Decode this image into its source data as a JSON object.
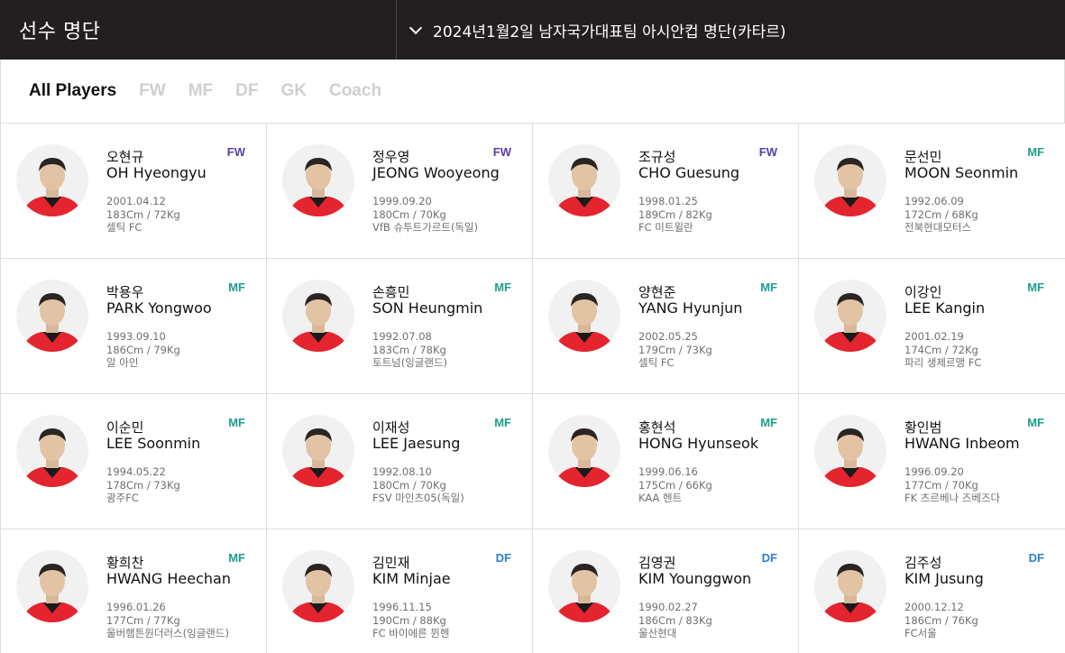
{
  "header": {
    "title": "선수 명단",
    "roster_select": "2024년1월2일 남자국가대표팀 아시안컵 명단(카타르)"
  },
  "filters": [
    "All Players",
    "FW",
    "MF",
    "DF",
    "GK",
    "Coach"
  ],
  "active_filter": "All Players",
  "colors": {
    "FW": "#5a3da6",
    "MF": "#1f9c8c",
    "DF": "#2c7fc9",
    "jersey": "#e4242e",
    "header_bg": "#231f20"
  },
  "players": [
    {
      "kr": "오현규",
      "en": "OH Hyeongyu",
      "pos": "FW",
      "dob": "2001.04.12",
      "body": "183Cm / 72Kg",
      "club": "셀틱 FC"
    },
    {
      "kr": "정우영",
      "en": "JEONG Wooyeong",
      "pos": "FW",
      "dob": "1999.09.20",
      "body": "180Cm / 70Kg",
      "club": "VfB 슈투트가르트(독일)"
    },
    {
      "kr": "조규성",
      "en": "CHO Guesung",
      "pos": "FW",
      "dob": "1998.01.25",
      "body": "189Cm / 82Kg",
      "club": "FC 미트윌란"
    },
    {
      "kr": "문선민",
      "en": "MOON Seonmin",
      "pos": "MF",
      "dob": "1992.06.09",
      "body": "172Cm / 68Kg",
      "club": "전북현대모터스"
    },
    {
      "kr": "박용우",
      "en": "PARK Yongwoo",
      "pos": "MF",
      "dob": "1993.09.10",
      "body": "186Cm / 79Kg",
      "club": "알 아인"
    },
    {
      "kr": "손흥민",
      "en": "SON Heungmin",
      "pos": "MF",
      "dob": "1992.07.08",
      "body": "183Cm / 78Kg",
      "club": "토트넘(잉글랜드)"
    },
    {
      "kr": "양현준",
      "en": "YANG Hyunjun",
      "pos": "MF",
      "dob": "2002.05.25",
      "body": "179Cm / 73Kg",
      "club": "셀틱 FC"
    },
    {
      "kr": "이강인",
      "en": "LEE Kangin",
      "pos": "MF",
      "dob": "2001.02.19",
      "body": "174Cm / 72Kg",
      "club": "파리 생제르맹 FC"
    },
    {
      "kr": "이순민",
      "en": "LEE Soonmin",
      "pos": "MF",
      "dob": "1994.05.22",
      "body": "178Cm / 73Kg",
      "club": "광주FC"
    },
    {
      "kr": "이재성",
      "en": "LEE Jaesung",
      "pos": "MF",
      "dob": "1992.08.10",
      "body": "180Cm / 70Kg",
      "club": "FSV 마인츠05(독일)"
    },
    {
      "kr": "홍현석",
      "en": "HONG Hyunseok",
      "pos": "MF",
      "dob": "1999.06.16",
      "body": "175Cm / 66Kg",
      "club": "KAA 헨트"
    },
    {
      "kr": "황인범",
      "en": "HWANG Inbeom",
      "pos": "MF",
      "dob": "1996.09.20",
      "body": "177Cm / 70Kg",
      "club": "FK 츠르베나 즈베즈다"
    },
    {
      "kr": "황희찬",
      "en": "HWANG Heechan",
      "pos": "MF",
      "dob": "1996.01.26",
      "body": "177Cm / 77Kg",
      "club": "울버햄튼원더러스(잉글랜드)"
    },
    {
      "kr": "김민재",
      "en": "KIM Minjae",
      "pos": "DF",
      "dob": "1996.11.15",
      "body": "190Cm / 88Kg",
      "club": "FC 바이에른 뮌헨"
    },
    {
      "kr": "김영권",
      "en": "KIM Younggwon",
      "pos": "DF",
      "dob": "1990.02.27",
      "body": "186Cm / 83Kg",
      "club": "울산현대"
    },
    {
      "kr": "김주성",
      "en": "KIM Jusung",
      "pos": "DF",
      "dob": "2000.12.12",
      "body": "186Cm / 76Kg",
      "club": "FC서울"
    }
  ]
}
